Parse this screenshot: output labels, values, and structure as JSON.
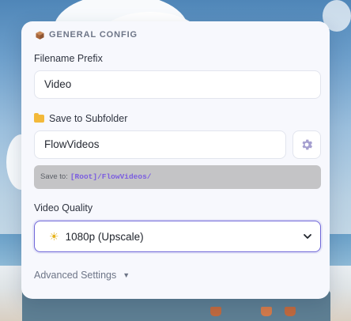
{
  "config": {
    "section_title": "GENERAL CONFIG",
    "filename_prefix": {
      "label": "Filename Prefix",
      "value": "Video"
    },
    "subfolder": {
      "label": "Save to Subfolder",
      "value": "FlowVideos"
    },
    "save_path": {
      "label": "Save to:",
      "value": "[Root]/FlowVideos/"
    },
    "video_quality": {
      "label": "Video Quality",
      "selected": "1080p (Upscale)"
    },
    "advanced_label": "Advanced Settings"
  },
  "icons": {
    "section": "cube-icon",
    "subfolder": "folder-icon",
    "gear": "gear-icon",
    "quality": "sun-icon",
    "select_arrow": "chevron-down-icon",
    "advanced": "triangle-down-icon"
  },
  "colors": {
    "accent": "#6f67d8",
    "path_text": "#7b5de0",
    "panel_bg": "#f7f8fd"
  }
}
